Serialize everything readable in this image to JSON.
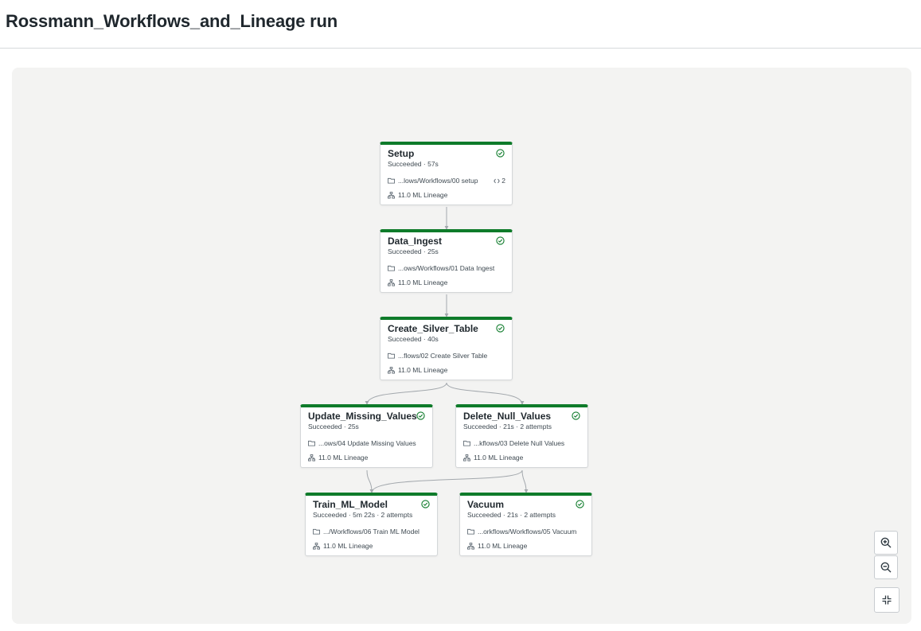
{
  "page": {
    "title": "Rossmann_Workflows_and_Lineage run"
  },
  "colors": {
    "success": "#0e7b2a",
    "edge": "#a3a8ad",
    "canvas": "#f3f3f2"
  },
  "tasks": [
    {
      "name": "Setup",
      "status": "Succeeded · 57s",
      "path": "...lows/Workflows/00 setup",
      "cluster": "11.0 ML Lineage",
      "params": "2"
    },
    {
      "name": "Data_Ingest",
      "status": "Succeeded · 25s",
      "path": "...ows/Workflows/01 Data Ingest",
      "cluster": "11.0 ML Lineage"
    },
    {
      "name": "Create_Silver_Table",
      "status": "Succeeded · 40s",
      "path": "...flows/02 Create Silver Table",
      "cluster": "11.0 ML Lineage"
    },
    {
      "name": "Update_Missing_Values",
      "status": "Succeeded · 25s",
      "path": "...ows/04 Update Missing Values",
      "cluster": "11.0 ML Lineage"
    },
    {
      "name": "Delete_Null_Values",
      "status": "Succeeded · 21s · 2 attempts",
      "path": "...kflows/03 Delete Null Values",
      "cluster": "11.0 ML Lineage"
    },
    {
      "name": "Train_ML_Model",
      "status": "Succeeded · 5m 22s · 2 attempts",
      "path": ".../Workflows/06 Train ML Model",
      "cluster": "11.0 ML Lineage"
    },
    {
      "name": "Vacuum",
      "status": "Succeeded · 21s · 2 attempts",
      "path": "...orkflows/Workflows/05 Vacuum",
      "cluster": "11.0 ML Lineage"
    }
  ],
  "controls": {
    "zoom_in_icon": "zoom-in-icon",
    "zoom_out_icon": "zoom-out-icon",
    "fit_icon": "fit-view-icon"
  }
}
